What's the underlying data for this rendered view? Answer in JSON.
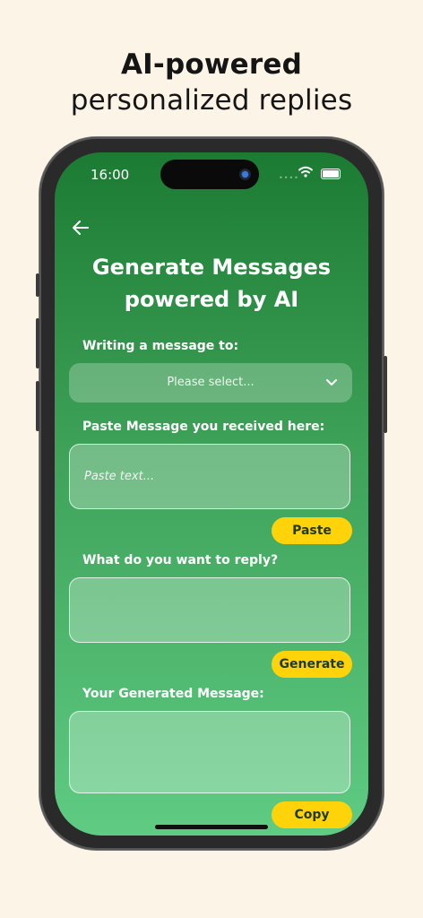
{
  "headline": {
    "line1": "AI-powered",
    "line2": "personalized replies"
  },
  "status_bar": {
    "time": "16:00"
  },
  "screen": {
    "back_icon": "arrow-left-icon",
    "title_line1": "Generate Messages",
    "title_line2": "powered by AI",
    "recipient": {
      "label": "Writing a message to:",
      "selected_value": "Please select..."
    },
    "received": {
      "label": "Paste Message you received here:",
      "placeholder": "Paste text...",
      "button": "Paste"
    },
    "reply": {
      "label": "What do you want to reply?",
      "value": "",
      "button": "Generate"
    },
    "generated": {
      "label": "Your Generated Message:",
      "value": "",
      "button": "Copy"
    }
  },
  "colors": {
    "background": "#fdf4e8",
    "accent": "#ffd30a",
    "green_top": "#1c7b32",
    "green_bottom": "#5fcb83"
  }
}
